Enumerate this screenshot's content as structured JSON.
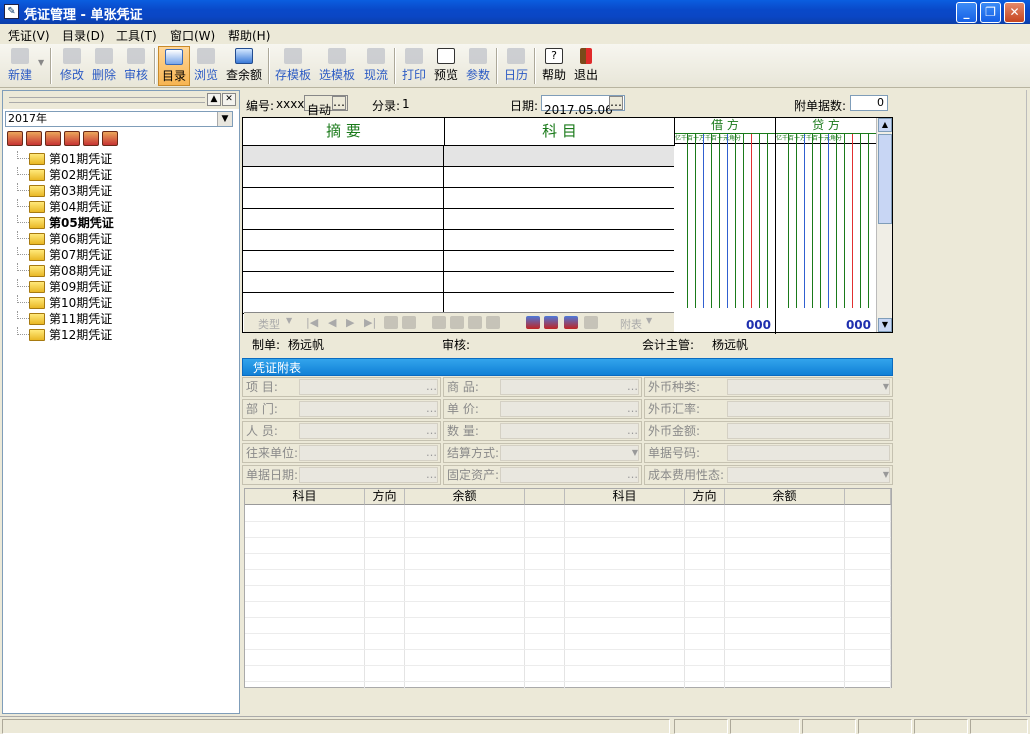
{
  "window": {
    "title": "凭证管理 - 单张凭证",
    "title_icon": "voucher-icon",
    "min": "_",
    "restore": "❐",
    "close": "✕"
  },
  "menu": [
    "凭证(V)",
    "目录(D)",
    "工具(T)",
    "窗口(W)",
    "帮助(H)"
  ],
  "toolbar": [
    {
      "label": "新建",
      "icon": "new-icon",
      "state": "disabled"
    },
    {
      "label": "修改",
      "icon": "edit-icon",
      "state": "disabled"
    },
    {
      "label": "删除",
      "icon": "delete-icon",
      "state": "disabled"
    },
    {
      "label": "审核",
      "icon": "audit-icon",
      "state": "disabled"
    },
    {
      "label": "目录",
      "icon": "catalog-icon",
      "state": "active"
    },
    {
      "label": "浏览",
      "icon": "browse-icon",
      "state": "disabled"
    },
    {
      "label": "查余额",
      "icon": "balance-icon",
      "state": "enabled"
    },
    {
      "label": "存模板",
      "icon": "save-template-icon",
      "state": "disabled"
    },
    {
      "label": "选模板",
      "icon": "select-template-icon",
      "state": "disabled"
    },
    {
      "label": "现流",
      "icon": "cashflow-icon",
      "state": "disabled"
    },
    {
      "label": "打印",
      "icon": "print-icon",
      "state": "disabled"
    },
    {
      "label": "预览",
      "icon": "preview-icon",
      "state": "enabled"
    },
    {
      "label": "参数",
      "icon": "params-icon",
      "state": "disabled"
    },
    {
      "label": "日历",
      "icon": "calendar-icon",
      "state": "disabled"
    },
    {
      "label": "帮助",
      "icon": "help-icon",
      "state": "enabled"
    },
    {
      "label": "退出",
      "icon": "exit-icon",
      "state": "enabled"
    }
  ],
  "sidebar": {
    "year": "2017年",
    "periods": [
      "第01期凭证",
      "第02期凭证",
      "第03期凭证",
      "第04期凭证",
      "第05期凭证",
      "第06期凭证",
      "第07期凭证",
      "第08期凭证",
      "第09期凭证",
      "第10期凭证",
      "第11期凭证",
      "第12期凭证"
    ],
    "selected": "第05期凭证"
  },
  "voucher": {
    "number_label": "编号:",
    "number_value": "xxxx",
    "auto_label": "自动",
    "entries_label": "分录:",
    "entries_value": "1",
    "date_label": "日期:",
    "date_value": "2017.05.06",
    "attach_label": "附单据数:",
    "attach_value": "0",
    "col_summary": "摘  要",
    "col_account": "科  目",
    "debit": "借  方",
    "credit": "贷  方",
    "digit_units": "亿千百十万千百十元角分",
    "debit_total": "000",
    "credit_total": "000",
    "grid_tools": [
      "类型",
      "附表"
    ]
  },
  "signatures": {
    "maker_label": "制单:",
    "maker": "杨远帆",
    "auditor_label": "审核:",
    "auditor": "",
    "supervisor_label": "会计主管:",
    "supervisor": "杨远帆"
  },
  "attachment": {
    "title": "凭证附表",
    "fields": [
      [
        "项  目:",
        "商  品:",
        "外币种类:"
      ],
      [
        "部  门:",
        "单  价:",
        "外币汇率:"
      ],
      [
        "人  员:",
        "数  量:",
        "外币金额:"
      ],
      [
        "往来单位:",
        "结算方式:",
        "单据号码:"
      ],
      [
        "单据日期:",
        "固定资产:",
        "成本费用性态:"
      ]
    ]
  },
  "balance": {
    "headers": [
      "科目",
      "方向",
      "余额",
      "科目",
      "方向",
      "余额"
    ]
  }
}
